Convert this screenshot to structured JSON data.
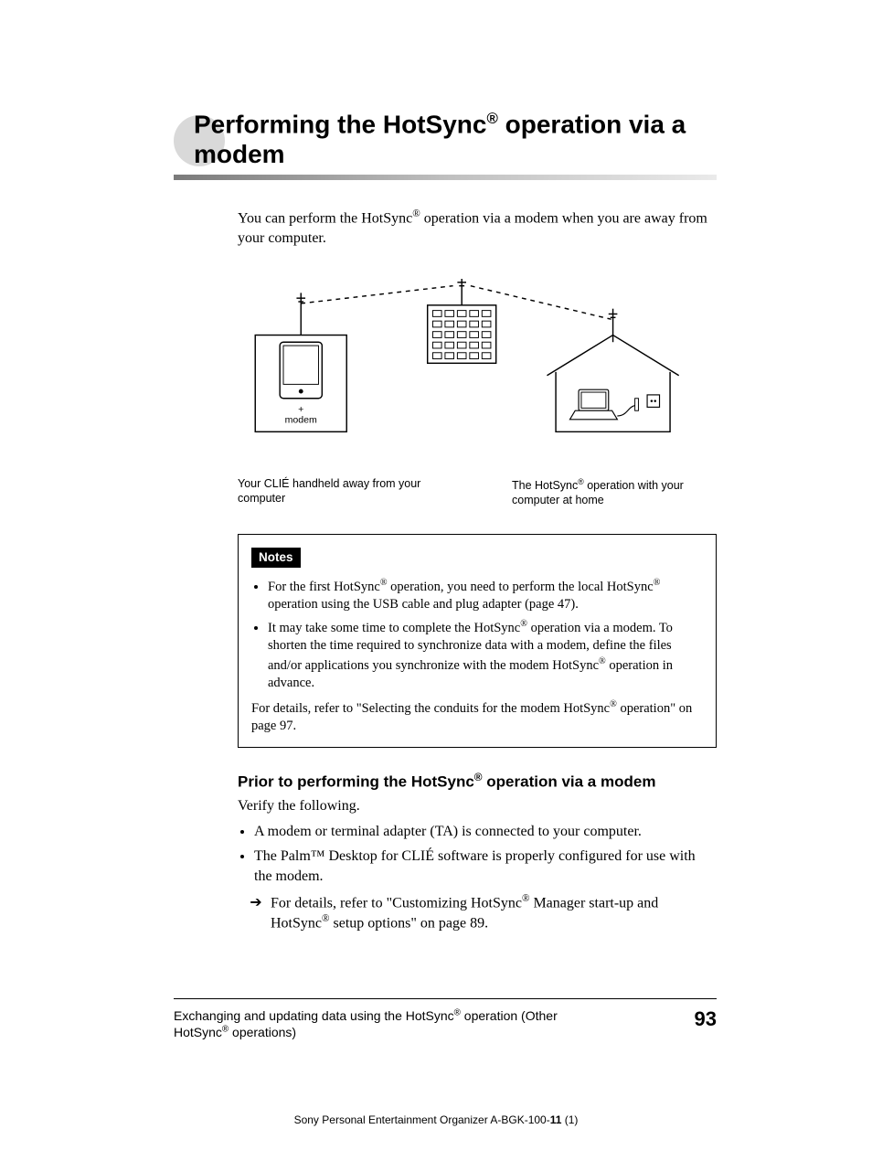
{
  "title": {
    "line1_a": "Performing the HotSync",
    "line1_b": " operation via a",
    "line2": "modem"
  },
  "intro": {
    "a": "You can perform the HotSync",
    "b": " operation via a modem when you are away from your computer."
  },
  "diagram": {
    "modem_label_plus": "+",
    "modem_label": "modem",
    "caption_left": "Your CLIÉ handheld away from your computer",
    "caption_right_a": "The HotSync",
    "caption_right_b": " operation with your computer at home"
  },
  "notes": {
    "label": "Notes",
    "items": [
      {
        "a": "For the first HotSync",
        "b": " operation, you need to perform the local HotSync",
        "c": " operation using the USB cable and plug adapter (page 47)."
      },
      {
        "a": "It may take some time to complete the HotSync",
        "b": " operation via a modem. To shorten the time required to synchronize data with a modem, define the files and/or applications you synchronize with the modem HotSync",
        "c": " operation in advance."
      }
    ],
    "tail_a": "For details, refer to \"Selecting the conduits for the modem HotSync",
    "tail_b": " operation\" on page 97."
  },
  "prior": {
    "heading_a": "Prior to performing the HotSync",
    "heading_b": " operation via a modem",
    "verify": "Verify the following.",
    "items": [
      {
        "text": "A modem or terminal adapter (TA) is connected to your computer."
      },
      {
        "text": "The Palm™ Desktop for CLIÉ software is properly configured for use with the modem."
      }
    ],
    "sub_a": "For details, refer to \"Customizing HotSync",
    "sub_b": " Manager start-up and HotSync",
    "sub_c": " setup options\" on page 89."
  },
  "footer": {
    "left_a": "Exchanging and updating data using the HotSync",
    "left_b": " operation (Other HotSync",
    "left_c": " operations)",
    "page": "93"
  },
  "bottom": {
    "prefix": "Sony Personal Entertainment Organizer   A-BGK-100-",
    "bold": "11",
    "suffix": " (1)"
  }
}
